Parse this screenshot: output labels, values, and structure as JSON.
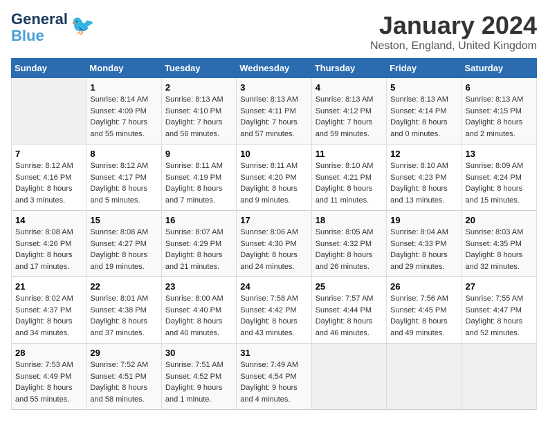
{
  "logo": {
    "line1": "General",
    "line2": "Blue"
  },
  "title": "January 2024",
  "subtitle": "Neston, England, United Kingdom",
  "headers": [
    "Sunday",
    "Monday",
    "Tuesday",
    "Wednesday",
    "Thursday",
    "Friday",
    "Saturday"
  ],
  "weeks": [
    [
      {
        "day": "",
        "sunrise": "",
        "sunset": "",
        "daylight": "",
        "empty": true
      },
      {
        "day": "1",
        "sunrise": "8:14 AM",
        "sunset": "4:09 PM",
        "daylight": "7 hours and 55 minutes."
      },
      {
        "day": "2",
        "sunrise": "8:13 AM",
        "sunset": "4:10 PM",
        "daylight": "7 hours and 56 minutes."
      },
      {
        "day": "3",
        "sunrise": "8:13 AM",
        "sunset": "4:11 PM",
        "daylight": "7 hours and 57 minutes."
      },
      {
        "day": "4",
        "sunrise": "8:13 AM",
        "sunset": "4:12 PM",
        "daylight": "7 hours and 59 minutes."
      },
      {
        "day": "5",
        "sunrise": "8:13 AM",
        "sunset": "4:14 PM",
        "daylight": "8 hours and 0 minutes."
      },
      {
        "day": "6",
        "sunrise": "8:13 AM",
        "sunset": "4:15 PM",
        "daylight": "8 hours and 2 minutes."
      }
    ],
    [
      {
        "day": "7",
        "sunrise": "8:12 AM",
        "sunset": "4:16 PM",
        "daylight": "8 hours and 3 minutes."
      },
      {
        "day": "8",
        "sunrise": "8:12 AM",
        "sunset": "4:17 PM",
        "daylight": "8 hours and 5 minutes."
      },
      {
        "day": "9",
        "sunrise": "8:11 AM",
        "sunset": "4:19 PM",
        "daylight": "8 hours and 7 minutes."
      },
      {
        "day": "10",
        "sunrise": "8:11 AM",
        "sunset": "4:20 PM",
        "daylight": "8 hours and 9 minutes."
      },
      {
        "day": "11",
        "sunrise": "8:10 AM",
        "sunset": "4:21 PM",
        "daylight": "8 hours and 11 minutes."
      },
      {
        "day": "12",
        "sunrise": "8:10 AM",
        "sunset": "4:23 PM",
        "daylight": "8 hours and 13 minutes."
      },
      {
        "day": "13",
        "sunrise": "8:09 AM",
        "sunset": "4:24 PM",
        "daylight": "8 hours and 15 minutes."
      }
    ],
    [
      {
        "day": "14",
        "sunrise": "8:08 AM",
        "sunset": "4:26 PM",
        "daylight": "8 hours and 17 minutes."
      },
      {
        "day": "15",
        "sunrise": "8:08 AM",
        "sunset": "4:27 PM",
        "daylight": "8 hours and 19 minutes."
      },
      {
        "day": "16",
        "sunrise": "8:07 AM",
        "sunset": "4:29 PM",
        "daylight": "8 hours and 21 minutes."
      },
      {
        "day": "17",
        "sunrise": "8:06 AM",
        "sunset": "4:30 PM",
        "daylight": "8 hours and 24 minutes."
      },
      {
        "day": "18",
        "sunrise": "8:05 AM",
        "sunset": "4:32 PM",
        "daylight": "8 hours and 26 minutes."
      },
      {
        "day": "19",
        "sunrise": "8:04 AM",
        "sunset": "4:33 PM",
        "daylight": "8 hours and 29 minutes."
      },
      {
        "day": "20",
        "sunrise": "8:03 AM",
        "sunset": "4:35 PM",
        "daylight": "8 hours and 32 minutes."
      }
    ],
    [
      {
        "day": "21",
        "sunrise": "8:02 AM",
        "sunset": "4:37 PM",
        "daylight": "8 hours and 34 minutes."
      },
      {
        "day": "22",
        "sunrise": "8:01 AM",
        "sunset": "4:38 PM",
        "daylight": "8 hours and 37 minutes."
      },
      {
        "day": "23",
        "sunrise": "8:00 AM",
        "sunset": "4:40 PM",
        "daylight": "8 hours and 40 minutes."
      },
      {
        "day": "24",
        "sunrise": "7:58 AM",
        "sunset": "4:42 PM",
        "daylight": "8 hours and 43 minutes."
      },
      {
        "day": "25",
        "sunrise": "7:57 AM",
        "sunset": "4:44 PM",
        "daylight": "8 hours and 46 minutes."
      },
      {
        "day": "26",
        "sunrise": "7:56 AM",
        "sunset": "4:45 PM",
        "daylight": "8 hours and 49 minutes."
      },
      {
        "day": "27",
        "sunrise": "7:55 AM",
        "sunset": "4:47 PM",
        "daylight": "8 hours and 52 minutes."
      }
    ],
    [
      {
        "day": "28",
        "sunrise": "7:53 AM",
        "sunset": "4:49 PM",
        "daylight": "8 hours and 55 minutes."
      },
      {
        "day": "29",
        "sunrise": "7:52 AM",
        "sunset": "4:51 PM",
        "daylight": "8 hours and 58 minutes."
      },
      {
        "day": "30",
        "sunrise": "7:51 AM",
        "sunset": "4:52 PM",
        "daylight": "9 hours and 1 minute."
      },
      {
        "day": "31",
        "sunrise": "7:49 AM",
        "sunset": "4:54 PM",
        "daylight": "9 hours and 4 minutes."
      },
      {
        "day": "",
        "empty": true
      },
      {
        "day": "",
        "empty": true
      },
      {
        "day": "",
        "empty": true
      }
    ]
  ],
  "labels": {
    "sunrise_prefix": "Sunrise: ",
    "sunset_prefix": "Sunset: ",
    "daylight_prefix": "Daylight: "
  }
}
